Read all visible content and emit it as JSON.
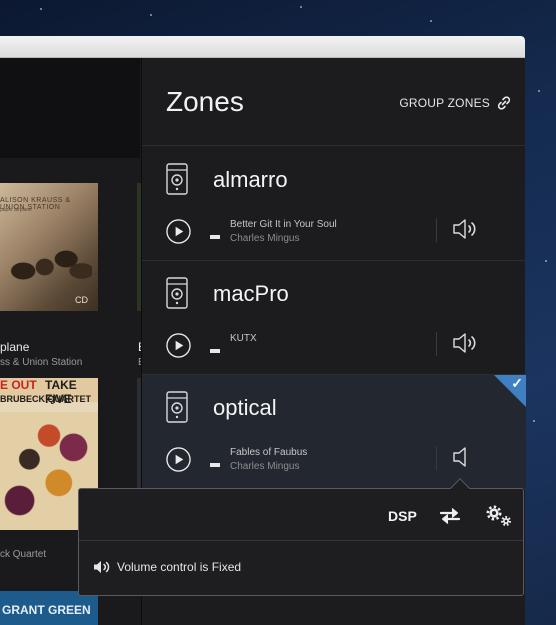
{
  "zones_panel": {
    "title": "Zones",
    "group_label": "GROUP ZONES"
  },
  "zones": [
    {
      "name": "almarro",
      "track": "Better Git It in Your Soul",
      "artist": "Charles Mingus",
      "selected": false
    },
    {
      "name": "macPro",
      "track": "KUTX",
      "artist": "",
      "selected": false
    },
    {
      "name": "optical",
      "track": "Fables of Faubus",
      "artist": "Charles Mingus",
      "selected": true
    }
  ],
  "popover": {
    "dsp_label": "DSP",
    "message": "Volume control is Fixed"
  },
  "library": {
    "album1_cover_title": "ALISON KRAUSS & UNION STATION",
    "album1_cover_sub": "paper airplane",
    "album1_cd": "CD",
    "album1_title": "plane",
    "album1_artist": "ss & Union Station",
    "album2_cover_t1": "E OUT",
    "album2_cover_t2": "TAKE FIVE",
    "album2_cover_t3": "BRUBECK QUARTET",
    "album2_cd": "C",
    "album2_artist": "ck Quartet",
    "album3_cover": "GRANT GREEN",
    "right_title": "E",
    "right_artist": "E"
  },
  "colors": {
    "accent": "#3f7fc2",
    "panel": "#1c1c1f",
    "selected_zone": "#232830"
  }
}
